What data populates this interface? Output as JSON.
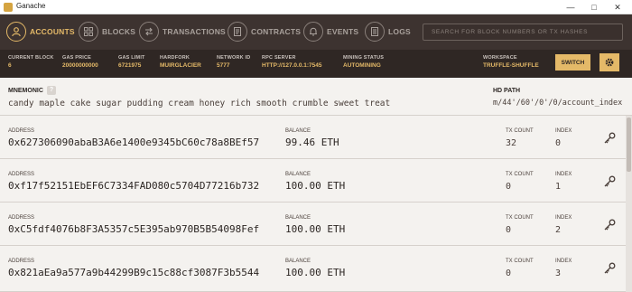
{
  "window": {
    "title": "Ganache"
  },
  "nav": {
    "items": [
      {
        "label": "ACCOUNTS",
        "icon": "user-icon",
        "active": true
      },
      {
        "label": "BLOCKS",
        "icon": "blocks-icon",
        "active": false
      },
      {
        "label": "TRANSACTIONS",
        "icon": "transactions-icon",
        "active": false
      },
      {
        "label": "CONTRACTS",
        "icon": "contracts-icon",
        "active": false
      },
      {
        "label": "EVENTS",
        "icon": "bell-icon",
        "active": false
      },
      {
        "label": "LOGS",
        "icon": "logs-icon",
        "active": false
      }
    ],
    "search_placeholder": "SEARCH FOR BLOCK NUMBERS OR TX HASHES"
  },
  "info": {
    "current_block": {
      "label": "CURRENT BLOCK",
      "value": "6"
    },
    "gas_price": {
      "label": "GAS PRICE",
      "value": "20000000000"
    },
    "gas_limit": {
      "label": "GAS LIMIT",
      "value": "6721975"
    },
    "hardfork": {
      "label": "HARDFORK",
      "value": "MUIRGLACIER"
    },
    "network_id": {
      "label": "NETWORK ID",
      "value": "5777"
    },
    "rpc_server": {
      "label": "RPC SERVER",
      "value": "HTTP://127.0.0.1:7545"
    },
    "mining_status": {
      "label": "MINING STATUS",
      "value": "AUTOMINING"
    },
    "workspace": {
      "label": "WORKSPACE",
      "value": "TRUFFLE-SHUFFLE"
    },
    "switch_label": "SWITCH"
  },
  "mnemonic": {
    "label": "MNEMONIC",
    "help": "?",
    "words": "candy maple cake sugar pudding cream honey rich smooth crumble sweet treat",
    "hd_label": "HD PATH",
    "hd_path": "m/44'/60'/0'/0/account_index"
  },
  "labels": {
    "address": "ADDRESS",
    "balance": "BALANCE",
    "tx_count": "TX COUNT",
    "index": "INDEX"
  },
  "accounts": [
    {
      "address": "0x627306090abaB3A6e1400e9345bC60c78a8BEf57",
      "balance": "99.46 ETH",
      "tx_count": "32",
      "index": "0"
    },
    {
      "address": "0xf17f52151EbEF6C7334FAD080c5704D77216b732",
      "balance": "100.00 ETH",
      "tx_count": "0",
      "index": "1"
    },
    {
      "address": "0xC5fdf4076b8F3A5357c5E395ab970B5B54098Fef",
      "balance": "100.00 ETH",
      "tx_count": "0",
      "index": "2"
    },
    {
      "address": "0x821aEa9a577a9b44299B9c15c88cf3087F3b5544",
      "balance": "100.00 ETH",
      "tx_count": "0",
      "index": "3"
    }
  ],
  "colors": {
    "accent": "#e4b968",
    "nav_bg": "#3d3330",
    "info_bg": "#2f2724",
    "content_bg": "#f4f2ef"
  }
}
